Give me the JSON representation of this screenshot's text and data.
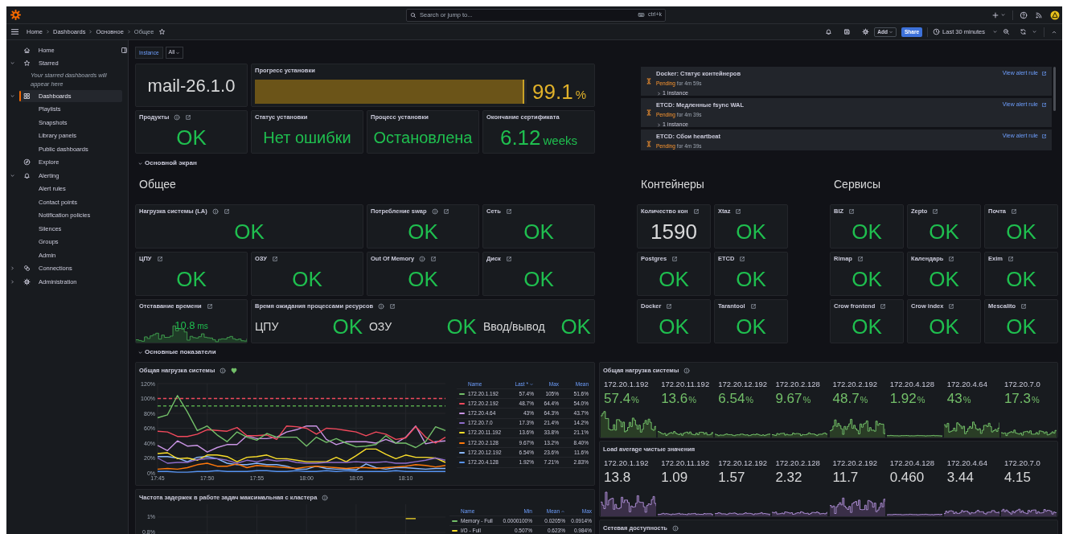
{
  "top_bar": {
    "search_placeholder": "Search or jump to...",
    "shortcut": "ctrl+k"
  },
  "breadcrumbs": [
    {
      "label": "Home",
      "current": false
    },
    {
      "label": "Dashboards",
      "current": false
    },
    {
      "label": "Основное",
      "current": false
    },
    {
      "label": "Общее",
      "current": true
    }
  ],
  "starred": false,
  "toolbar": {
    "add": "Add",
    "share": "Share",
    "time_range": "Last 30 minutes"
  },
  "sidebar": {
    "items": [
      {
        "label": "Home",
        "selected": false
      },
      {
        "label": "Starred",
        "selected": false,
        "expanded": true,
        "note": "Your starred dashboards will appear here"
      },
      {
        "label": "Dashboards",
        "selected": true,
        "expanded": true,
        "children": [
          {
            "label": "Playlists",
            "selected": false
          },
          {
            "label": "Snapshots",
            "selected": false
          },
          {
            "label": "Library panels",
            "selected": false
          },
          {
            "label": "Public dashboards",
            "selected": false
          }
        ]
      },
      {
        "label": "Explore",
        "selected": false
      },
      {
        "label": "Alerting",
        "selected": false,
        "expanded": true,
        "children": [
          {
            "label": "Alert rules",
            "selected": false
          },
          {
            "label": "Contact points",
            "selected": false
          },
          {
            "label": "Notification policies",
            "selected": false
          },
          {
            "label": "Silences",
            "selected": false
          },
          {
            "label": "Groups",
            "selected": false
          },
          {
            "label": "Admin",
            "selected": false
          }
        ]
      },
      {
        "label": "Connections",
        "selected": false,
        "expanded": false
      },
      {
        "label": "Administration",
        "selected": false,
        "expanded": false
      }
    ]
  },
  "variables": [
    {
      "label": "Instance",
      "value": "All"
    }
  ],
  "summary": {
    "version": "mail-26.1.0",
    "progress": {
      "title": "Прогресс установки",
      "level": 0.991,
      "value": "99.1",
      "unit": "%"
    },
    "stats": [
      {
        "title": "Продукты",
        "info": true,
        "link": true,
        "value": "OK"
      },
      {
        "title": "Статус установки",
        "info": false,
        "link": false,
        "value": "Нет ошибки"
      },
      {
        "title": "Процесс установки",
        "info": false,
        "link": false,
        "value": "Остановлена"
      },
      {
        "title": "Окончание сертификата",
        "info": false,
        "link": false,
        "value": "6.12",
        "unit": "weeks"
      }
    ]
  },
  "alerts": [
    {
      "title": "Docker: Статус контейнеров",
      "state": "Pending",
      "duration": "for 4m 59s",
      "instances": "1 instance",
      "link": "View alert rule"
    },
    {
      "title": "ETCD: Медленные fsync WAL",
      "state": "Pending",
      "duration": "for 4m 39s",
      "instances": "1 instance",
      "link": "View alert rule"
    },
    {
      "title": "ETCD: Сбои heartbeat",
      "state": "Pending",
      "duration": "for 4m 39s",
      "link": "View alert rule"
    }
  ],
  "main_row": {
    "label": "Основной экран",
    "expanded": true
  },
  "groups": [
    {
      "title": "Общее",
      "panels": [
        {
          "kind": "stat",
          "title": "Нагрузка системы (LA)",
          "info": true,
          "link": true,
          "value": "OK"
        },
        {
          "kind": "stat",
          "title": "Потребление swap",
          "info": true,
          "link": true,
          "value": "OK"
        },
        {
          "kind": "stat",
          "title": "Сеть",
          "info": false,
          "link": true,
          "value": "OK"
        },
        {
          "kind": "stat",
          "title": "ЦПУ",
          "info": false,
          "link": true,
          "value": "OK"
        },
        {
          "kind": "stat",
          "title": "ОЗУ",
          "info": false,
          "link": true,
          "value": "OK"
        },
        {
          "kind": "stat",
          "title": "Out Of Memory",
          "info": true,
          "link": true,
          "value": "OK"
        },
        {
          "kind": "stat",
          "title": "Диск",
          "info": false,
          "link": true,
          "value": "OK"
        },
        {
          "kind": "sparkline",
          "title": "Отставание времени",
          "info": false,
          "link": true,
          "value": "10.8",
          "unit": "ms"
        },
        {
          "kind": "multi",
          "title": "Время ожидания процессами ресурсов",
          "info": true,
          "link": true,
          "items": [
            {
              "label": "ЦПУ",
              "value": "OK"
            },
            {
              "label": "ОЗУ",
              "value": "OK"
            },
            {
              "label": "Ввод/вывод",
              "value": "OK"
            }
          ]
        }
      ]
    },
    {
      "title": "Контейнеры",
      "panels": [
        {
          "kind": "stat",
          "title": "Количество кон",
          "info": false,
          "link": true,
          "value": "1590",
          "color": "#d8d9da"
        },
        {
          "kind": "stat",
          "title": "Xtaz",
          "info": false,
          "link": true,
          "value": "OK",
          "color": "#1fbf4f"
        },
        {
          "kind": "stat",
          "title": "Postgres",
          "info": false,
          "link": true,
          "value": "OK",
          "color": "#1fbf4f"
        },
        {
          "kind": "stat",
          "title": "ETCD",
          "info": false,
          "link": true,
          "value": "OK",
          "color": "#1fbf4f"
        },
        {
          "kind": "stat",
          "title": "Docker",
          "info": false,
          "link": true,
          "value": "OK",
          "color": "#1fbf4f"
        },
        {
          "kind": "stat",
          "title": "Tarantool",
          "info": false,
          "link": true,
          "value": "OK",
          "color": "#1fbf4f"
        }
      ]
    },
    {
      "title": "Сервисы",
      "panels": [
        {
          "kind": "stat",
          "title": "BIZ",
          "info": false,
          "link": true,
          "value": "OK"
        },
        {
          "kind": "stat",
          "title": "Zepto",
          "info": false,
          "link": true,
          "value": "OK"
        },
        {
          "kind": "stat",
          "title": "Почта",
          "info": false,
          "link": true,
          "value": "OK"
        },
        {
          "kind": "stat",
          "title": "Rimap",
          "info": false,
          "link": true,
          "value": "OK"
        },
        {
          "kind": "stat",
          "title": "Календарь",
          "info": false,
          "link": true,
          "value": "OK"
        },
        {
          "kind": "stat",
          "title": "Exim",
          "info": false,
          "link": true,
          "value": "OK"
        },
        {
          "kind": "stat",
          "title": "Crow frontend",
          "info": false,
          "link": true,
          "value": "OK"
        },
        {
          "kind": "stat",
          "title": "Crow index",
          "info": false,
          "link": true,
          "value": "OK"
        },
        {
          "kind": "stat",
          "title": "Mescalito",
          "info": false,
          "link": true,
          "value": "OK"
        }
      ]
    }
  ],
  "metrics_row": {
    "label": "Основные показатели",
    "expanded": true
  },
  "charts": [
    {
      "title": "Общая нагрузка системы",
      "info": true,
      "healthy": true,
      "legend": {
        "columns": [
          {
            "label": "Name",
            "sorted": false
          },
          {
            "label": "Last *",
            "sorted": true,
            "ascending": false
          },
          {
            "label": "Max",
            "sorted": false
          },
          {
            "label": "Mean",
            "sorted": false
          }
        ],
        "rows": [
          {
            "values": [
              "57.4%",
              "105%",
              "51.6%"
            ]
          },
          {
            "values": [
              "48.7%",
              "64.4%",
              "54.0%"
            ]
          },
          {
            "values": [
              "43%",
              "64.3%",
              "43.7%"
            ]
          },
          {
            "values": [
              "17.3%",
              "21.4%",
              "14.2%"
            ]
          },
          {
            "values": [
              "13.6%",
              "33.8%",
              "21.1%"
            ]
          },
          {
            "values": [
              "9.67%",
              "13.2%",
              "8.40%"
            ]
          },
          {
            "values": [
              "6.54%",
              "23.6%",
              "11.6%"
            ]
          },
          {
            "values": [
              "1.92%",
              "7.21%",
              "2.83%"
            ]
          }
        ]
      },
      "chart_data": {
        "type": "line",
        "grid": true,
        "categories": [
          "17:45",
          null,
          null,
          null,
          null,
          "17:50",
          null,
          null,
          null,
          null,
          "17:55",
          null,
          null,
          null,
          null,
          "18:00",
          null,
          null,
          null,
          null,
          "18:05",
          null,
          null,
          null,
          null,
          "18:10",
          null,
          null,
          null,
          null
        ],
        "ylim": [
          0,
          120
        ],
        "yticks": [
          {
            "value": 0,
            "label": "0%"
          },
          {
            "value": 20,
            "label": "20%"
          },
          {
            "value": 40,
            "label": "40%"
          },
          {
            "value": 60,
            "label": "60%"
          },
          {
            "value": 80,
            "label": "80%"
          },
          {
            "value": 100,
            "label": "100%"
          },
          {
            "value": 120,
            "label": "120%"
          }
        ],
        "ref_lines": [
          {
            "axis": "y",
            "value": 100,
            "color": "#f2495c"
          },
          {
            "axis": "y",
            "value": 90,
            "color": "#56a64b"
          }
        ],
        "series": [
          {
            "name": "172.20.1.192",
            "color": "#73bf69",
            "values": [
              74,
              78,
              104,
              82,
              57,
              63,
              51,
              42,
              55,
              48,
              44,
              53,
              48,
              48,
              48,
              36,
              48,
              41,
              46,
              40,
              35,
              36,
              38,
              50,
              40,
              40,
              34,
              42,
              62,
              57
            ]
          },
          {
            "name": "172.20.2.192",
            "color": "#f2495c",
            "values": [
              56,
              55,
              49,
              49,
              52,
              58,
              57,
              56,
              61,
              50,
              50,
              51,
              45,
              63,
              62,
              60,
              52,
              60,
              59,
              57,
              55,
              50,
              55,
              52,
              45,
              47,
              62,
              48,
              40,
              48
            ]
          },
          {
            "name": "172.20.4.64",
            "color": "#ca95e5",
            "values": [
              37,
              30,
              43,
              36,
              37,
              28,
              34,
              38,
              38,
              50,
              46,
              46,
              48,
              55,
              58,
              63,
              63,
              45,
              38,
              42,
              42,
              42,
              40,
              45,
              40,
              48,
              63,
              39,
              42,
              43
            ]
          },
          {
            "name": "172.20.7.0",
            "color": "#8f6dcc",
            "values": [
              20,
              13,
              14,
              14,
              18,
              19,
              19,
              17,
              13,
              17,
              15,
              18,
              16,
              17,
              14,
              13,
              13,
              14,
              14,
              14,
              15,
              14,
              14,
              15,
              13,
              13,
              15,
              17,
              20,
              17
            ]
          },
          {
            "name": "172.20.11.192",
            "color": "#fade2a",
            "values": [
              26,
              27,
              19,
              20,
              17,
              24,
              24,
              22,
              15,
              21,
              22,
              24,
              19,
              19,
              17,
              15,
              15,
              15,
              21,
              15,
              23,
              32,
              32,
              25,
              19,
              24,
              21,
              21,
              20,
              14
            ]
          },
          {
            "name": "172.20.2.128",
            "color": "#ff780a",
            "values": [
              5,
              6,
              5,
              7,
              11,
              13,
              9,
              9,
              12,
              7,
              10,
              9,
              8,
              7,
              6,
              8,
              9,
              8,
              7,
              6,
              7,
              7,
              6,
              7,
              8,
              9,
              11,
              10,
              8,
              10
            ]
          },
          {
            "name": "172.20.12.192",
            "color": "#8ab8ff",
            "values": [
              22,
              22,
              20,
              15,
              21,
              22,
              19,
              13,
              11,
              11,
              13,
              11,
              11,
              9,
              5,
              5,
              9,
              6,
              5,
              5,
              4,
              12,
              7,
              5,
              7,
              7,
              6,
              5,
              6,
              6
            ]
          },
          {
            "name": "172.20.4.128",
            "color": "#5794f2",
            "values": [
              2,
              2,
              1,
              1,
              2,
              2,
              3,
              2,
              2,
              2,
              3,
              3,
              2,
              2,
              3,
              2,
              2,
              3,
              2,
              3,
              2,
              2,
              2,
              2,
              3,
              2,
              2,
              2,
              2,
              2
            ]
          }
        ]
      }
    },
    {
      "title": "Частота задержек в работе задач максимальная с кластера",
      "info": true,
      "legend": {
        "columns": [
          {
            "label": "Name",
            "sorted": false
          },
          {
            "label": "Min",
            "sorted": false
          },
          {
            "label": "Mean",
            "sorted": true,
            "ascending": true
          },
          {
            "label": "Max",
            "sorted": false
          }
        ],
        "rows": [
          {
            "values": [
              "0.0000100%",
              "0.0205%",
              "0.0914%"
            ]
          },
          {
            "values": [
              "0.507%",
              "0.623%",
              "0.984%"
            ]
          }
        ]
      },
      "chart_data": {
        "type": "line",
        "grid": true,
        "categories": [
          null,
          null,
          null,
          null,
          null,
          null,
          null,
          null,
          null,
          null,
          null,
          null,
          null,
          null,
          null,
          null,
          null,
          null,
          null,
          null,
          null,
          null,
          null,
          null,
          null,
          null,
          null,
          null,
          null,
          null
        ],
        "ylim": [
          0,
          1.168
        ],
        "yticks": [
          {
            "value": 0.8,
            "label": "0.8%"
          },
          {
            "value": 1,
            "label": "1%"
          }
        ],
        "series": [
          {
            "name": "Memory - Full",
            "color": "#73bf69",
            "values": [
              null,
              null,
              null,
              null,
              null,
              null,
              null,
              null,
              null,
              null,
              null,
              null,
              null,
              null,
              null,
              null,
              null,
              null,
              null,
              null,
              null,
              null,
              null,
              null,
              null,
              null,
              null,
              null,
              null,
              null
            ]
          },
          {
            "name": "I/O - Full",
            "color": "#fade2a",
            "values": [
              null,
              null,
              null,
              null,
              null,
              null,
              null,
              null,
              null,
              null,
              null,
              null,
              null,
              null,
              null,
              null,
              null,
              null,
              null,
              null,
              null,
              null,
              null,
              null,
              null,
              0.98,
              0.98,
              null,
              null,
              null
            ]
          }
        ]
      }
    }
  ],
  "stat_grids": [
    {
      "kind": "percent",
      "title": "Общая нагрузка системы",
      "info": true,
      "items": [
        {
          "name": "172.20.1.192",
          "value": "57.4",
          "unit": "%"
        },
        {
          "name": "172.20.11.192",
          "value": "13.6",
          "unit": "%"
        },
        {
          "name": "172.20.12.192",
          "value": "6.54",
          "unit": "%"
        },
        {
          "name": "172.20.2.128",
          "value": "9.67",
          "unit": "%"
        },
        {
          "name": "172.20.2.192",
          "value": "48.7",
          "unit": "%"
        },
        {
          "name": "172.20.4.128",
          "value": "1.92",
          "unit": "%"
        },
        {
          "name": "172.20.4.64",
          "value": "43",
          "unit": "%"
        },
        {
          "name": "172.20.7.0",
          "value": "17.3",
          "unit": "%"
        }
      ]
    },
    {
      "kind": "plain",
      "title": "Load average чистые значения",
      "info": false,
      "items": [
        {
          "name": "172.20.1.192",
          "value": "13.8"
        },
        {
          "name": "172.20.11.192",
          "value": "1.09"
        },
        {
          "name": "172.20.12.192",
          "value": "1.57"
        },
        {
          "name": "172.20.2.128",
          "value": "2.32"
        },
        {
          "name": "172.20.2.192",
          "value": "11.7"
        },
        {
          "name": "172.20.4.128",
          "value": "0.460"
        },
        {
          "name": "172.20.4.64",
          "value": "3.44"
        },
        {
          "name": "172.20.7.0",
          "value": "4.15"
        }
      ]
    },
    {
      "kind": "empty",
      "title": "Сетевая доступность",
      "info": true
    }
  ]
}
